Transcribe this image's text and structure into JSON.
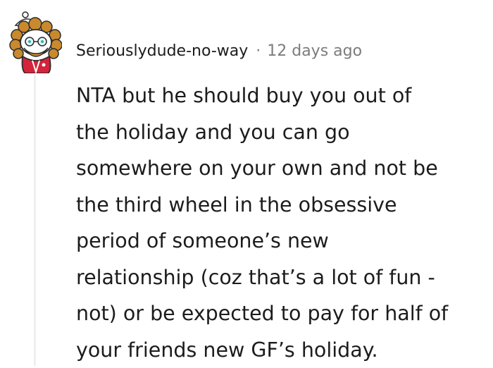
{
  "comment": {
    "author": "Seriouslydude-no-way",
    "separator": "·",
    "timestamp": "12 days ago",
    "body": "NTA but he should buy you out of\nthe holiday and you can go\nsomewhere on your own and not be\nthe third wheel in the obsessive\nperiod of someone’s new\nrelationship (coz that’s a lot of fun -\nnot) or be expected to pay for half of\nyour friends new GF’s holiday."
  },
  "avatar": {
    "icon": "snoo-avatar-icon"
  },
  "colors": {
    "text": "#1c1c1c",
    "meta": "#7c7c7c",
    "thread_line": "#edeff1",
    "avatar_outfit": "#d4233b"
  }
}
